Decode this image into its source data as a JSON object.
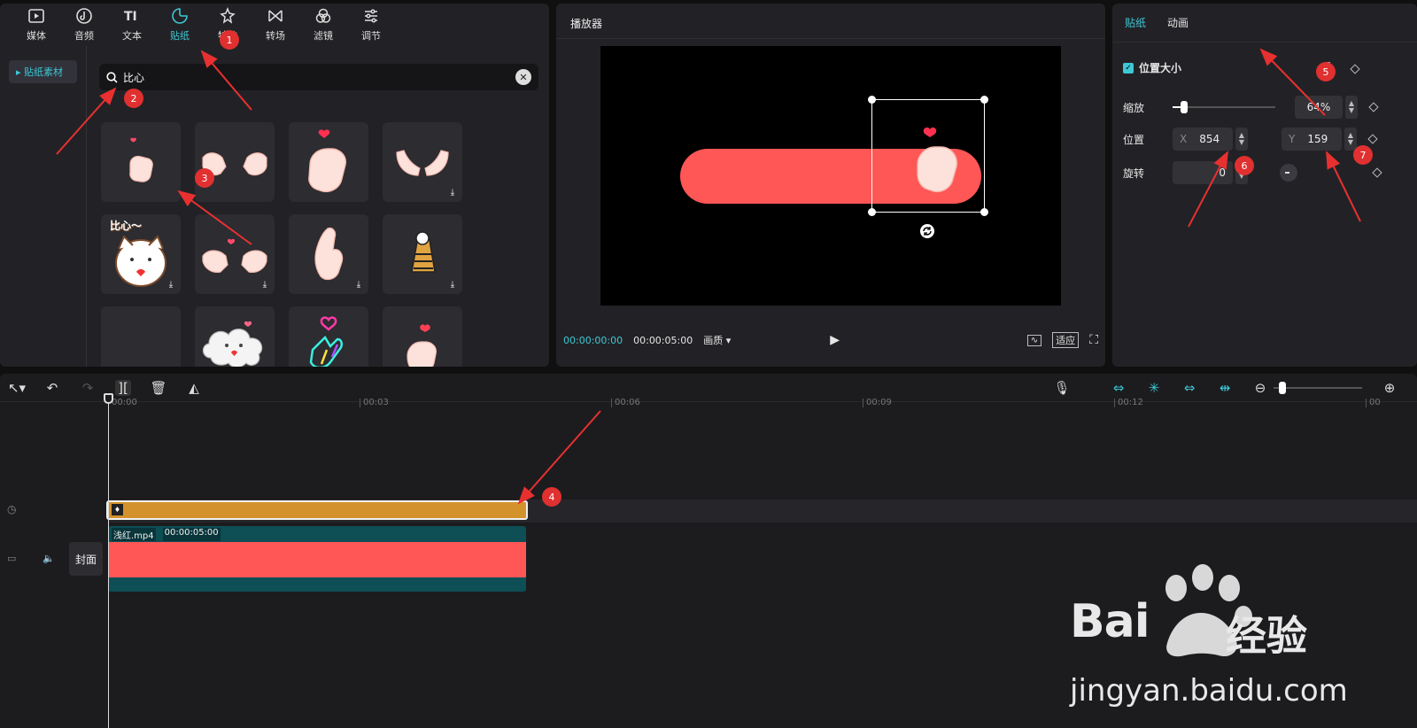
{
  "media_toolbar": {
    "items": [
      {
        "label": "媒体",
        "icon": "media-icon"
      },
      {
        "label": "音频",
        "icon": "audio-icon"
      },
      {
        "label": "文本",
        "icon": "text-icon"
      },
      {
        "label": "贴纸",
        "icon": "sticker-icon",
        "active": true
      },
      {
        "label": "特效",
        "icon": "effects-icon"
      },
      {
        "label": "转场",
        "icon": "transition-icon"
      },
      {
        "label": "滤镜",
        "icon": "filter-icon"
      },
      {
        "label": "调节",
        "icon": "adjust-icon"
      }
    ]
  },
  "sidebar": {
    "item": "▸ 贴纸素材"
  },
  "search": {
    "value": "比心"
  },
  "sticker_grid": {
    "text_sticker": "比心～",
    "cloud_sticker": "比心"
  },
  "player": {
    "title": "播放器",
    "current_time": "00:00:00:00",
    "duration": "00:00:05:00",
    "quality": "画质",
    "fit": "适应"
  },
  "props": {
    "tabs": [
      "贴纸",
      "动画"
    ],
    "section": "位置大小",
    "scale_label": "缩放",
    "scale_value": "64%",
    "scale_fraction": 0.08,
    "position_label": "位置",
    "x_prefix": "X",
    "x_value": "854",
    "y_prefix": "Y",
    "y_value": "159",
    "rotate_label": "旋转",
    "rotate_value": "0"
  },
  "timeline": {
    "ticks": [
      "00:00",
      "00:03",
      "00:06",
      "00:09",
      "00:12",
      "00"
    ],
    "video_name": "浅红.mp4",
    "video_duration": "00:00:05:00",
    "cover": "封面"
  },
  "annotations": [
    "1",
    "2",
    "3",
    "4",
    "5",
    "6",
    "7"
  ],
  "watermark": {
    "brand_a": "Bai",
    "brand_b": "经验",
    "url": "jingyan.baidu.com"
  },
  "colors": {
    "accent": "#3ec8d4",
    "clip_sticker": "#d4922d",
    "clip_video": "#0e4e55",
    "pill": "#ff5656",
    "marker": "#e03030"
  }
}
